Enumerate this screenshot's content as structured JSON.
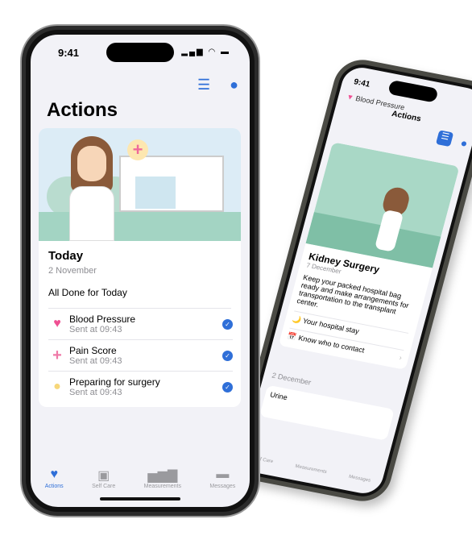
{
  "back_phone": {
    "time": "9:41",
    "title": "Actions",
    "prev_item": "Blood Pressure",
    "card": {
      "title": "Kidney Surgery",
      "date": "7 December",
      "body": "Keep your packed hospital bag ready and make arrangements for transportation to the transplant center.",
      "links": [
        {
          "icon": "moon-icon",
          "label": "Your hospital stay"
        },
        {
          "icon": "calendar-heart-icon",
          "label": "Know who to contact"
        }
      ]
    },
    "next_date": "2 December",
    "next_item": "Urine",
    "tabs": [
      "Self Care",
      "Measurements",
      "Messages"
    ]
  },
  "front_phone": {
    "time": "9:41",
    "title": "Actions",
    "header_icons": [
      "list-icon",
      "profile-icon"
    ],
    "card": {
      "heading": "Today",
      "date": "2 November",
      "status": "All Done for Today",
      "items": [
        {
          "icon": "heart-icon",
          "name": "Blood Pressure",
          "sent": "Sent at 09:43",
          "done": true
        },
        {
          "icon": "plus-icon",
          "name": "Pain Score",
          "sent": "Sent at 09:43",
          "done": true
        },
        {
          "icon": "lightbulb-icon",
          "name": "Preparing for surgery",
          "sent": "Sent at 09:43",
          "done": true
        }
      ]
    },
    "tabs": [
      {
        "label": "Actions",
        "icon": "heart-icon",
        "active": true
      },
      {
        "label": "Self Care",
        "icon": "clipboard-icon"
      },
      {
        "label": "Measurements",
        "icon": "bar-chart-icon"
      },
      {
        "label": "Messages",
        "icon": "chat-icon"
      }
    ]
  },
  "colors": {
    "accent": "#2f6fd8",
    "pink": "#ef4f92",
    "background": "#f2f2f7"
  }
}
